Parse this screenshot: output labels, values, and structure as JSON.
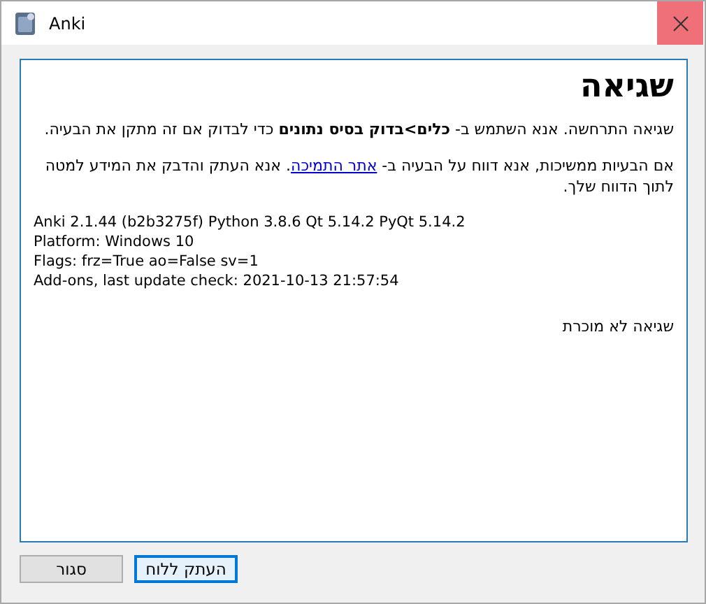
{
  "window": {
    "title": "Anki"
  },
  "heading": "שגיאה",
  "paragraph_1": "שגיאה התרחשה. אנא השתמש ב- **כלים>בדוק בסיס נתונים** כדי לבדוק אם זה מתקן את הבעיה.",
  "paragraph_2": {
    "before": "אם הבעיות ממשיכות, אנא דווח על הבעיה ב- ",
    "link": "אתר התמיכה",
    "after": ". אנא העתק והדבק את המידע למטה לתוך הדווח שלך."
  },
  "details": [
    "Anki 2.1.44 (b2b3275f) Python 3.8.6 Qt 5.14.2 PyQt 5.14.2",
    "Platform: Windows 10",
    "Flags: frz=True ao=False sv=1",
    "Add-ons, last update check: 2021-10-13 21:57:54"
  ],
  "error_message": "שגיאה לא מוכרת",
  "buttons": [
    {
      "label": "העתק ללוח",
      "focused": true
    },
    {
      "label": "סגור",
      "focused": false
    }
  ]
}
